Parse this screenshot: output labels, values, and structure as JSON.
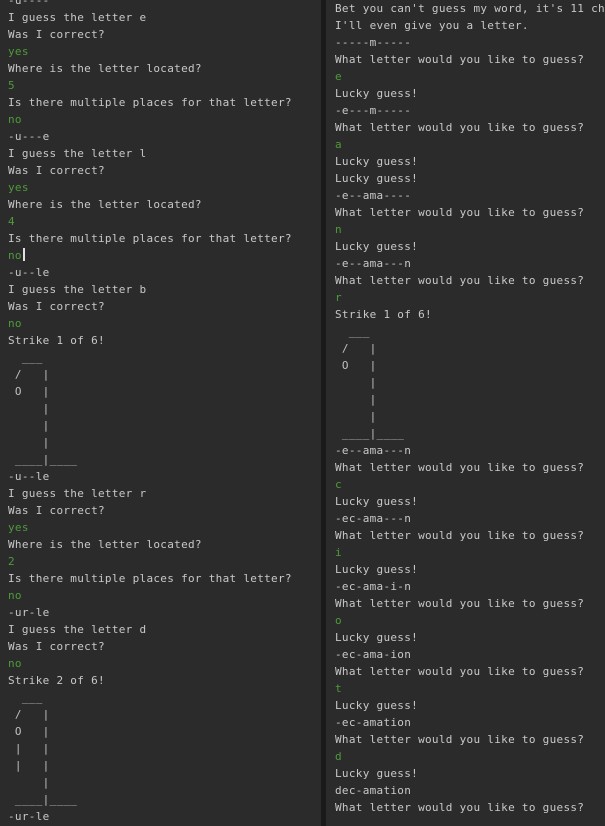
{
  "left_terminal": {
    "lines": [
      {
        "text": "-u----",
        "kind": "out"
      },
      {
        "text": "I guess the letter e",
        "kind": "out"
      },
      {
        "text": "Was I correct?",
        "kind": "out"
      },
      {
        "text": "yes",
        "kind": "in"
      },
      {
        "text": "Where is the letter located?",
        "kind": "out"
      },
      {
        "text": "5",
        "kind": "in"
      },
      {
        "text": "Is there multiple places for that letter?",
        "kind": "out"
      },
      {
        "text": "no",
        "kind": "in"
      },
      {
        "text": "-u---e",
        "kind": "out"
      },
      {
        "text": "I guess the letter l",
        "kind": "out"
      },
      {
        "text": "Was I correct?",
        "kind": "out"
      },
      {
        "text": "yes",
        "kind": "in"
      },
      {
        "text": "Where is the letter located?",
        "kind": "out"
      },
      {
        "text": "4",
        "kind": "in"
      },
      {
        "text": "Is there multiple places for that letter?",
        "kind": "out"
      },
      {
        "text": "no",
        "kind": "in",
        "cursor": true
      },
      {
        "text": "-u--le",
        "kind": "out"
      },
      {
        "text": "I guess the letter b",
        "kind": "out"
      },
      {
        "text": "Was I correct?",
        "kind": "out"
      },
      {
        "text": "no",
        "kind": "in"
      },
      {
        "text": "Strike 1 of 6!",
        "kind": "out"
      },
      {
        "text": "  ___",
        "kind": "art"
      },
      {
        "text": " /   |",
        "kind": "art"
      },
      {
        "text": " O   |",
        "kind": "art"
      },
      {
        "text": "     |",
        "kind": "art"
      },
      {
        "text": "     |",
        "kind": "art"
      },
      {
        "text": "     |",
        "kind": "art"
      },
      {
        "text": " ____|____",
        "kind": "art"
      },
      {
        "text": "-u--le",
        "kind": "out"
      },
      {
        "text": "I guess the letter r",
        "kind": "out"
      },
      {
        "text": "Was I correct?",
        "kind": "out"
      },
      {
        "text": "yes",
        "kind": "in"
      },
      {
        "text": "Where is the letter located?",
        "kind": "out"
      },
      {
        "text": "2",
        "kind": "in"
      },
      {
        "text": "Is there multiple places for that letter?",
        "kind": "out"
      },
      {
        "text": "no",
        "kind": "in"
      },
      {
        "text": "-ur-le",
        "kind": "out"
      },
      {
        "text": "I guess the letter d",
        "kind": "out"
      },
      {
        "text": "Was I correct?",
        "kind": "out"
      },
      {
        "text": "no",
        "kind": "in"
      },
      {
        "text": "Strike 2 of 6!",
        "kind": "out"
      },
      {
        "text": "  ___",
        "kind": "art"
      },
      {
        "text": " /   |",
        "kind": "art"
      },
      {
        "text": " O   |",
        "kind": "art"
      },
      {
        "text": " |   |",
        "kind": "art"
      },
      {
        "text": " |   |",
        "kind": "art"
      },
      {
        "text": "     |",
        "kind": "art"
      },
      {
        "text": " ____|____",
        "kind": "art"
      },
      {
        "text": "-ur-le",
        "kind": "out"
      }
    ]
  },
  "right_terminal": {
    "lines": [
      {
        "text": "Bet you can't guess my word, it's 11 ch",
        "kind": "out"
      },
      {
        "text": "I'll even give you a letter.",
        "kind": "out"
      },
      {
        "text": "-----m-----",
        "kind": "out"
      },
      {
        "text": "What letter would you like to guess?",
        "kind": "out"
      },
      {
        "text": "e",
        "kind": "in"
      },
      {
        "text": "Lucky guess!",
        "kind": "out"
      },
      {
        "text": "-e---m-----",
        "kind": "out"
      },
      {
        "text": "What letter would you like to guess?",
        "kind": "out"
      },
      {
        "text": "a",
        "kind": "in"
      },
      {
        "text": "Lucky guess!",
        "kind": "out"
      },
      {
        "text": "Lucky guess!",
        "kind": "out"
      },
      {
        "text": "-e--ama----",
        "kind": "out"
      },
      {
        "text": "What letter would you like to guess?",
        "kind": "out"
      },
      {
        "text": "n",
        "kind": "in"
      },
      {
        "text": "Lucky guess!",
        "kind": "out"
      },
      {
        "text": "-e--ama---n",
        "kind": "out"
      },
      {
        "text": "What letter would you like to guess?",
        "kind": "out"
      },
      {
        "text": "r",
        "kind": "in"
      },
      {
        "text": "Strike 1 of 6!",
        "kind": "out"
      },
      {
        "text": "  ___",
        "kind": "art"
      },
      {
        "text": " /   |",
        "kind": "art"
      },
      {
        "text": " O   |",
        "kind": "art"
      },
      {
        "text": "     |",
        "kind": "art"
      },
      {
        "text": "     |",
        "kind": "art"
      },
      {
        "text": "     |",
        "kind": "art"
      },
      {
        "text": " ____|____",
        "kind": "art"
      },
      {
        "text": "-e--ama---n",
        "kind": "out"
      },
      {
        "text": "What letter would you like to guess?",
        "kind": "out"
      },
      {
        "text": "c",
        "kind": "in"
      },
      {
        "text": "Lucky guess!",
        "kind": "out"
      },
      {
        "text": "-ec-ama---n",
        "kind": "out"
      },
      {
        "text": "What letter would you like to guess?",
        "kind": "out"
      },
      {
        "text": "i",
        "kind": "in"
      },
      {
        "text": "Lucky guess!",
        "kind": "out"
      },
      {
        "text": "-ec-ama-i-n",
        "kind": "out"
      },
      {
        "text": "What letter would you like to guess?",
        "kind": "out"
      },
      {
        "text": "o",
        "kind": "in"
      },
      {
        "text": "Lucky guess!",
        "kind": "out"
      },
      {
        "text": "-ec-ama-ion",
        "kind": "out"
      },
      {
        "text": "What letter would you like to guess?",
        "kind": "out"
      },
      {
        "text": "t",
        "kind": "in"
      },
      {
        "text": "Lucky guess!",
        "kind": "out"
      },
      {
        "text": "-ec-amation",
        "kind": "out"
      },
      {
        "text": "What letter would you like to guess?",
        "kind": "out"
      },
      {
        "text": "d",
        "kind": "in"
      },
      {
        "text": "Lucky guess!",
        "kind": "out"
      },
      {
        "text": "dec-amation",
        "kind": "out"
      },
      {
        "text": "What letter would you like to guess?",
        "kind": "out"
      }
    ]
  },
  "colors": {
    "background": "#2b2b2b",
    "output_text": "#c8c8c8",
    "input_text": "#4f9a3a",
    "divider": "#1a1a1a"
  }
}
